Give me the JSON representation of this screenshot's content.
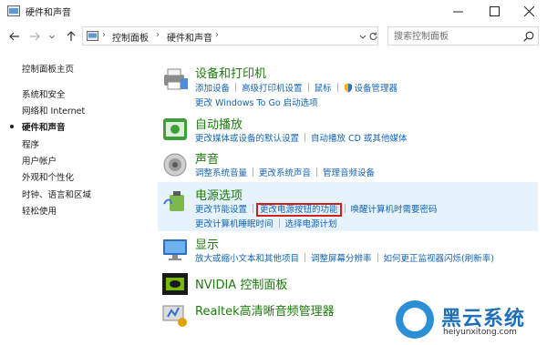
{
  "window": {
    "title": "硬件和声音"
  },
  "address": {
    "crumbs": [
      "控制面板",
      "硬件和声音"
    ]
  },
  "search": {
    "placeholder": "搜索控制面板"
  },
  "sidebar": {
    "items": [
      {
        "label": "控制面板主页",
        "active": false
      },
      {
        "label": "系统和安全",
        "active": false
      },
      {
        "label": "网络和 Internet",
        "active": false
      },
      {
        "label": "硬件和声音",
        "active": true
      },
      {
        "label": "程序",
        "active": false
      },
      {
        "label": "用户帐户",
        "active": false
      },
      {
        "label": "外观和个性化",
        "active": false
      },
      {
        "label": "时钟、语言和区域",
        "active": false
      },
      {
        "label": "轻松使用",
        "active": false
      }
    ]
  },
  "categories": {
    "devices": {
      "title": "设备和打印机",
      "row1": [
        "添加设备",
        "高级打印机设置",
        "鼠标",
        "设备管理器"
      ],
      "row2": [
        "更改 Windows To Go 启动选项"
      ]
    },
    "autoplay": {
      "title": "自动播放",
      "row1": [
        "更改媒体或设备的默认设置",
        "自动播放 CD 或其他媒体"
      ]
    },
    "sound": {
      "title": "声音",
      "row1": [
        "调整系统音量",
        "更改系统声音",
        "管理音频设备"
      ]
    },
    "power": {
      "title": "电源选项",
      "row1": [
        "更改节能设置",
        "更改电源按钮的功能",
        "唤醒计算机时需要密码"
      ],
      "row2": [
        "更改计算机睡眠时间",
        "选择电源计划"
      ]
    },
    "display": {
      "title": "显示",
      "row1": [
        "放大或缩小文本和其他项目",
        "调整屏幕分辨率",
        "如何更正监视器闪烁(刷新率)"
      ]
    },
    "nvidia": {
      "title": "NVIDIA 控制面板"
    },
    "realtek": {
      "title": "Realtek高清晰音频管理器"
    }
  },
  "watermark": {
    "title": "黑云系统",
    "url": "heiyunxitong.com"
  },
  "colors": {
    "category_title": "#1e7a0f",
    "link": "#1464b4",
    "highlight_bg": "#e6f3fc",
    "red_box": "#d21f1f"
  }
}
